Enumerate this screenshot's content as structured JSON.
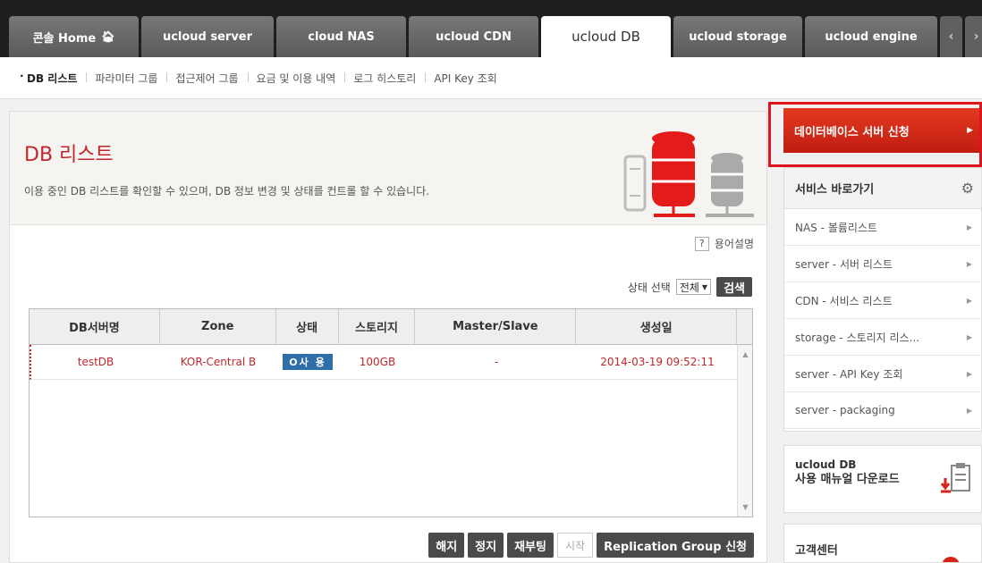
{
  "tabs": [
    {
      "label": "콘솔 Home",
      "width": 145
    },
    {
      "label": "ucloud server",
      "width": 148
    },
    {
      "label": "cloud NAS",
      "width": 145
    },
    {
      "label": "ucloud CDN",
      "width": 145
    },
    {
      "label": "ucloud DB",
      "width": 145,
      "active": true
    },
    {
      "label": "ucloud storage",
      "width": 144
    },
    {
      "label": "ucloud engine",
      "width": 148
    }
  ],
  "submenu": [
    "DB 리스트",
    "파라미터 그룹",
    "접근제어 그룹",
    "요금 및 이용 내역",
    "로그 히스토리",
    "API Key 조회"
  ],
  "page": {
    "title": "DB 리스트",
    "description": "이용 중인 DB 리스트를 확인할 수 있으며, DB 정보 변경 및 상태를 컨트롤 할 수 있습니다.",
    "glossary_icon_text": "?",
    "glossary": "용어설명"
  },
  "filter": {
    "label": "상태 선택",
    "selected": "전체",
    "search": "검색"
  },
  "table": {
    "headers": [
      "DB서버명",
      "Zone",
      "상태",
      "스토리지",
      "Master/Slave",
      "생성일"
    ],
    "rows": [
      [
        "testDB",
        "KOR-Central B",
        "O사 용",
        "100GB",
        "-",
        "2014-03-19 09:52:11"
      ]
    ]
  },
  "actions": {
    "terminate": "해지",
    "stop": "정지",
    "reboot": "재부팅",
    "start": "시작",
    "replication": "Replication Group 신청"
  },
  "sidebar": {
    "apply": "데이터베이스 서버 신청",
    "shortcut_title": "서비스 바로가기",
    "items": [
      "NAS - 볼륨리스트",
      "server - 서버 리스트",
      "CDN - 서비스 리스트",
      "storage - 스토리지 리스...",
      "server - API Key 조회",
      "server - packaging"
    ],
    "manual_title": "ucloud DB",
    "manual_sub": "사용 매뉴얼 다운로드",
    "cs_title": "고객센터"
  },
  "colors": {
    "accent": "#c1272d",
    "badge": "#2f6ea8",
    "apply": "#e33a1f"
  }
}
